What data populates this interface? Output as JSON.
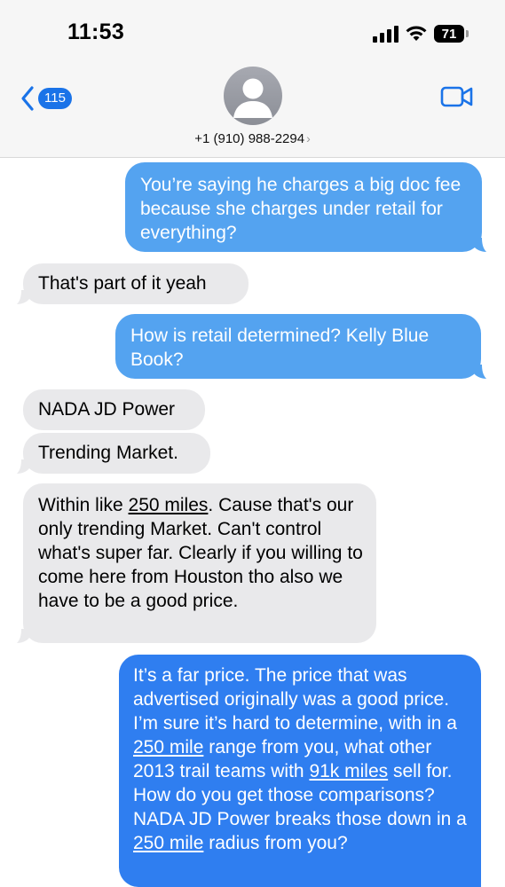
{
  "status_bar": {
    "time": "11:53",
    "battery": "71"
  },
  "nav": {
    "unread_count": "115",
    "contact_number": "+1 (910) 988-2294"
  },
  "colors": {
    "outgoing": "#54a3f0",
    "outgoing_alt": "#2f7ef0",
    "incoming": "#e9e9eb",
    "accent": "#1a73e8"
  },
  "messages": [
    {
      "direction": "outgoing",
      "text": "You’re saying he charges a big doc fee because she charges under retail for everything?"
    },
    {
      "direction": "incoming",
      "text": "That's part of it yeah"
    },
    {
      "direction": "outgoing",
      "text": "How is retail determined? Kelly Blue Book?"
    },
    {
      "direction": "incoming",
      "text": "NADA JD Power"
    },
    {
      "direction": "incoming",
      "text": "Trending Market."
    },
    {
      "direction": "incoming",
      "parts": [
        "Within like ",
        "250 miles",
        ". Cause that's our only trending Market. Can't control what's super far. Clearly if you willing to come here from Houston tho also we have to be a good price."
      ]
    },
    {
      "direction": "outgoing",
      "parts": [
        "It’s a far price.  The price that was advertised originally was a good price.  I’m sure it’s hard to determine, with in a ",
        "250 mile",
        " range from you, what other 2013 trail teams with ",
        "91k miles",
        " sell for.  How do you get those comparisons? NADA JD Power breaks those down in a ",
        "250 mile",
        " radius from you?"
      ]
    }
  ]
}
